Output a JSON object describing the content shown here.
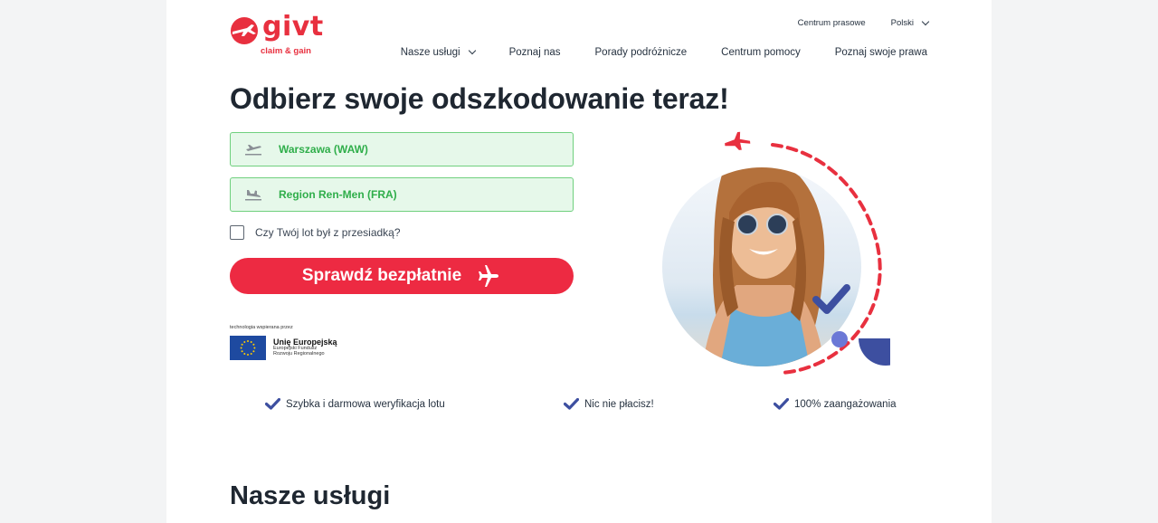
{
  "brand": {
    "name": "givt",
    "tagline": "claim & gain",
    "color": "#e8303f"
  },
  "topbar": {
    "press": "Centrum prasowe",
    "language": "Polski"
  },
  "nav": {
    "items": [
      {
        "label": "Nasze usługi",
        "has_dropdown": true
      },
      {
        "label": "Poznaj nas"
      },
      {
        "label": "Porady podróżnicze"
      },
      {
        "label": "Centrum pomocy"
      },
      {
        "label": "Poznaj swoje prawa"
      }
    ]
  },
  "hero": {
    "title": "Odbierz swoje odszkodowanie teraz!",
    "departure": {
      "value": "Warszawa (WAW)",
      "icon": "plane-takeoff-icon"
    },
    "arrival": {
      "value": "Region Ren-Men (FRA)",
      "icon": "plane-landing-icon"
    },
    "transfer_label": "Czy Twój lot był z przesiadką?",
    "transfer_checked": false,
    "cta_label": "Sprawdź bezpłatnie"
  },
  "eu": {
    "small": "technologia wspierana przez",
    "name": "Unię Europejską",
    "sub1": "Europejski Fundusz",
    "sub2": "Rozwoju Regionalnego"
  },
  "features": [
    "Szybka i darmowa weryfikacja lotu",
    "Nic nie płacisz!",
    "100% zaangażowania"
  ],
  "services_title": "Nasze usługi",
  "colors": {
    "accent": "#ed2a42",
    "green_border": "#6fd07e",
    "green_bg": "#e6f8ea",
    "green_text": "#2fae4a",
    "navy": "#3d4fa0"
  }
}
